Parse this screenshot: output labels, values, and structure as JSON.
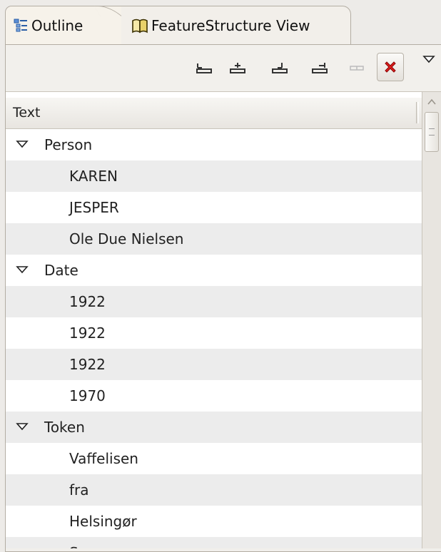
{
  "tabs": [
    {
      "label": "Outline",
      "icon": "outline-icon",
      "active": true
    },
    {
      "label": "FeatureStructure View",
      "icon": "book-icon",
      "active": false
    }
  ],
  "toolbar": {
    "buttons": [
      {
        "name": "shift-left-button",
        "icon": "shift-left-icon"
      },
      {
        "name": "shift-right-button",
        "icon": "shift-right-icon"
      },
      {
        "name": "shift-up-button",
        "icon": "shift-up-icon"
      },
      {
        "name": "shift-down-button",
        "icon": "shift-down-icon"
      },
      {
        "name": "merge-button",
        "icon": "merge-icon",
        "enabled": false
      }
    ],
    "close_icon": "red-x-icon",
    "menu_icon": "view-menu-triangle-icon"
  },
  "table": {
    "column_header": "Text",
    "rows": [
      {
        "label": "Person",
        "level": 0,
        "expanded": true
      },
      {
        "label": "KAREN",
        "level": 1
      },
      {
        "label": "JESPER",
        "level": 1
      },
      {
        "label": "Ole Due Nielsen",
        "level": 1
      },
      {
        "label": "Date",
        "level": 0,
        "expanded": true
      },
      {
        "label": "1922",
        "level": 1
      },
      {
        "label": "1922",
        "level": 1
      },
      {
        "label": "1922",
        "level": 1
      },
      {
        "label": "1970",
        "level": 1
      },
      {
        "label": "Token",
        "level": 0,
        "expanded": true
      },
      {
        "label": "Vaffelisen",
        "level": 1
      },
      {
        "label": "fra",
        "level": 1
      },
      {
        "label": "Helsingør",
        "level": 1
      },
      {
        "label": "Søsonen",
        "level": 1
      }
    ]
  },
  "colors": {
    "accent_close": "#e02020",
    "alt_row": "#ececec"
  }
}
